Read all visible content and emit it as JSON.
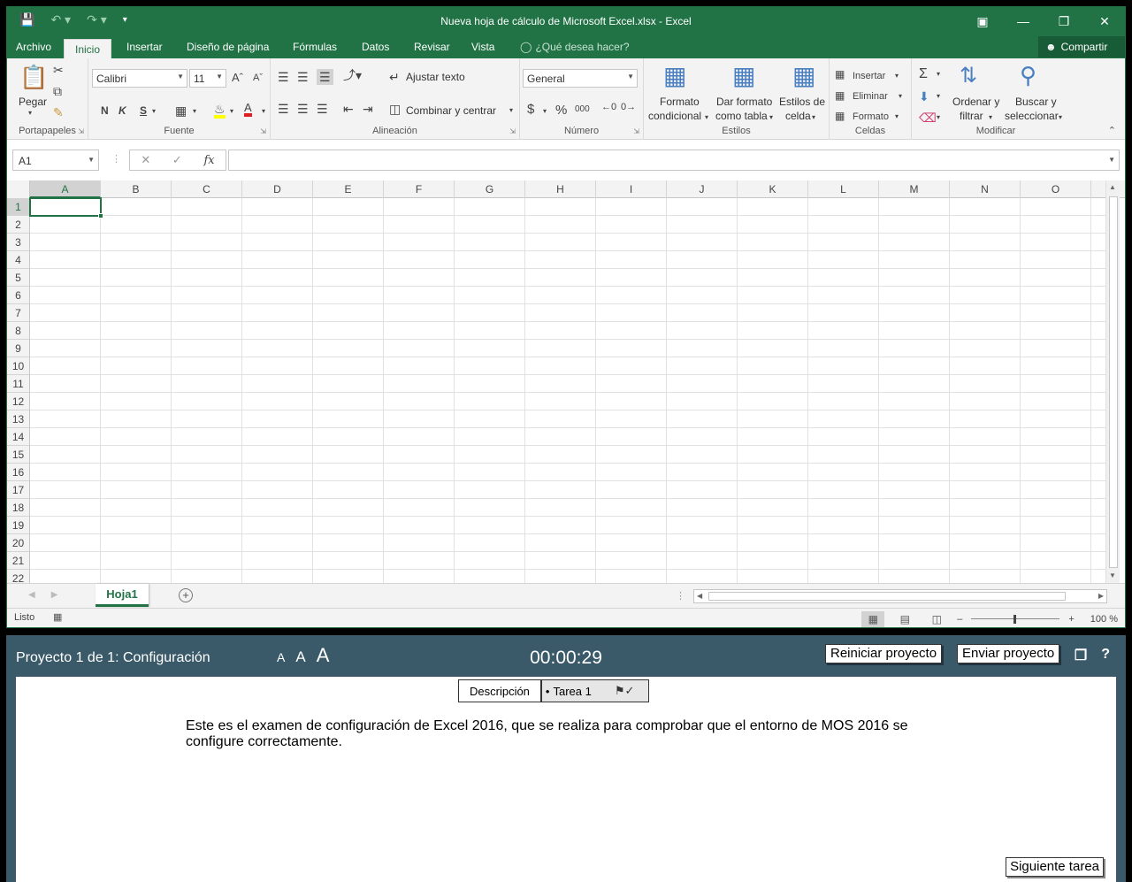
{
  "window": {
    "title": "Nueva hoja de cálculo de Microsoft Excel.xlsx - Excel"
  },
  "ribbon_tabs": [
    "Archivo",
    "Inicio",
    "Insertar",
    "Diseño de página",
    "Fórmulas",
    "Datos",
    "Revisar",
    "Vista"
  ],
  "tell_me": "¿Qué desea hacer?",
  "share": "Compartir",
  "ribbon": {
    "clipboard": {
      "paste": "Pegar",
      "label": "Portapapeles"
    },
    "font": {
      "name": "Calibri",
      "size": "11",
      "bold": "N",
      "italic": "K",
      "underline": "S",
      "label": "Fuente"
    },
    "alignment": {
      "wrap": "Ajustar texto",
      "merge": "Combinar y centrar",
      "label": "Alineación"
    },
    "number": {
      "format": "General",
      "currency": "$",
      "percent": "%",
      "thousands": "000",
      "label": "Número"
    },
    "styles": {
      "conditional_1": "Formato",
      "conditional_2": "condicional",
      "table_1": "Dar formato",
      "table_2": "como tabla",
      "cell_1": "Estilos de",
      "cell_2": "celda",
      "label": "Estilos"
    },
    "cells": {
      "insert": "Insertar",
      "delete": "Eliminar",
      "format": "Formato",
      "label": "Celdas"
    },
    "editing": {
      "sort_1": "Ordenar y",
      "sort_2": "filtrar",
      "find_1": "Buscar y",
      "find_2": "seleccionar",
      "label": "Modificar"
    }
  },
  "formula_bar": {
    "name_box": "A1",
    "fx": "fx",
    "formula": ""
  },
  "grid": {
    "columns": [
      "A",
      "B",
      "C",
      "D",
      "E",
      "F",
      "G",
      "H",
      "I",
      "J",
      "K",
      "L",
      "M",
      "N",
      "O"
    ],
    "rows": [
      "1",
      "2",
      "3",
      "4",
      "5",
      "6",
      "7",
      "8",
      "9",
      "10",
      "11",
      "12",
      "13",
      "14",
      "15",
      "16",
      "17",
      "18",
      "19",
      "20",
      "21",
      "22"
    ],
    "active_cell": "A1"
  },
  "sheets": [
    "Hoja1"
  ],
  "status": {
    "text": "Listo",
    "zoom": "100 %"
  },
  "exam": {
    "project": "Proyecto 1 de 1: Configuración",
    "font_sizes": [
      "A",
      "A",
      "A"
    ],
    "timer": "00:00:29",
    "reset": "Reiniciar proyecto",
    "submit": "Enviar proyecto",
    "help": "?",
    "tabs": {
      "description": "Descripción",
      "task": "Tarea 1"
    },
    "description": "Este es el examen de configuración de Excel 2016, que se realiza para comprobar que el entorno de MOS 2016 se configure correctamente.",
    "next": "Siguiente tarea"
  },
  "colors": {
    "excel_green": "#217346",
    "exam_bar": "#3a5a6a"
  }
}
